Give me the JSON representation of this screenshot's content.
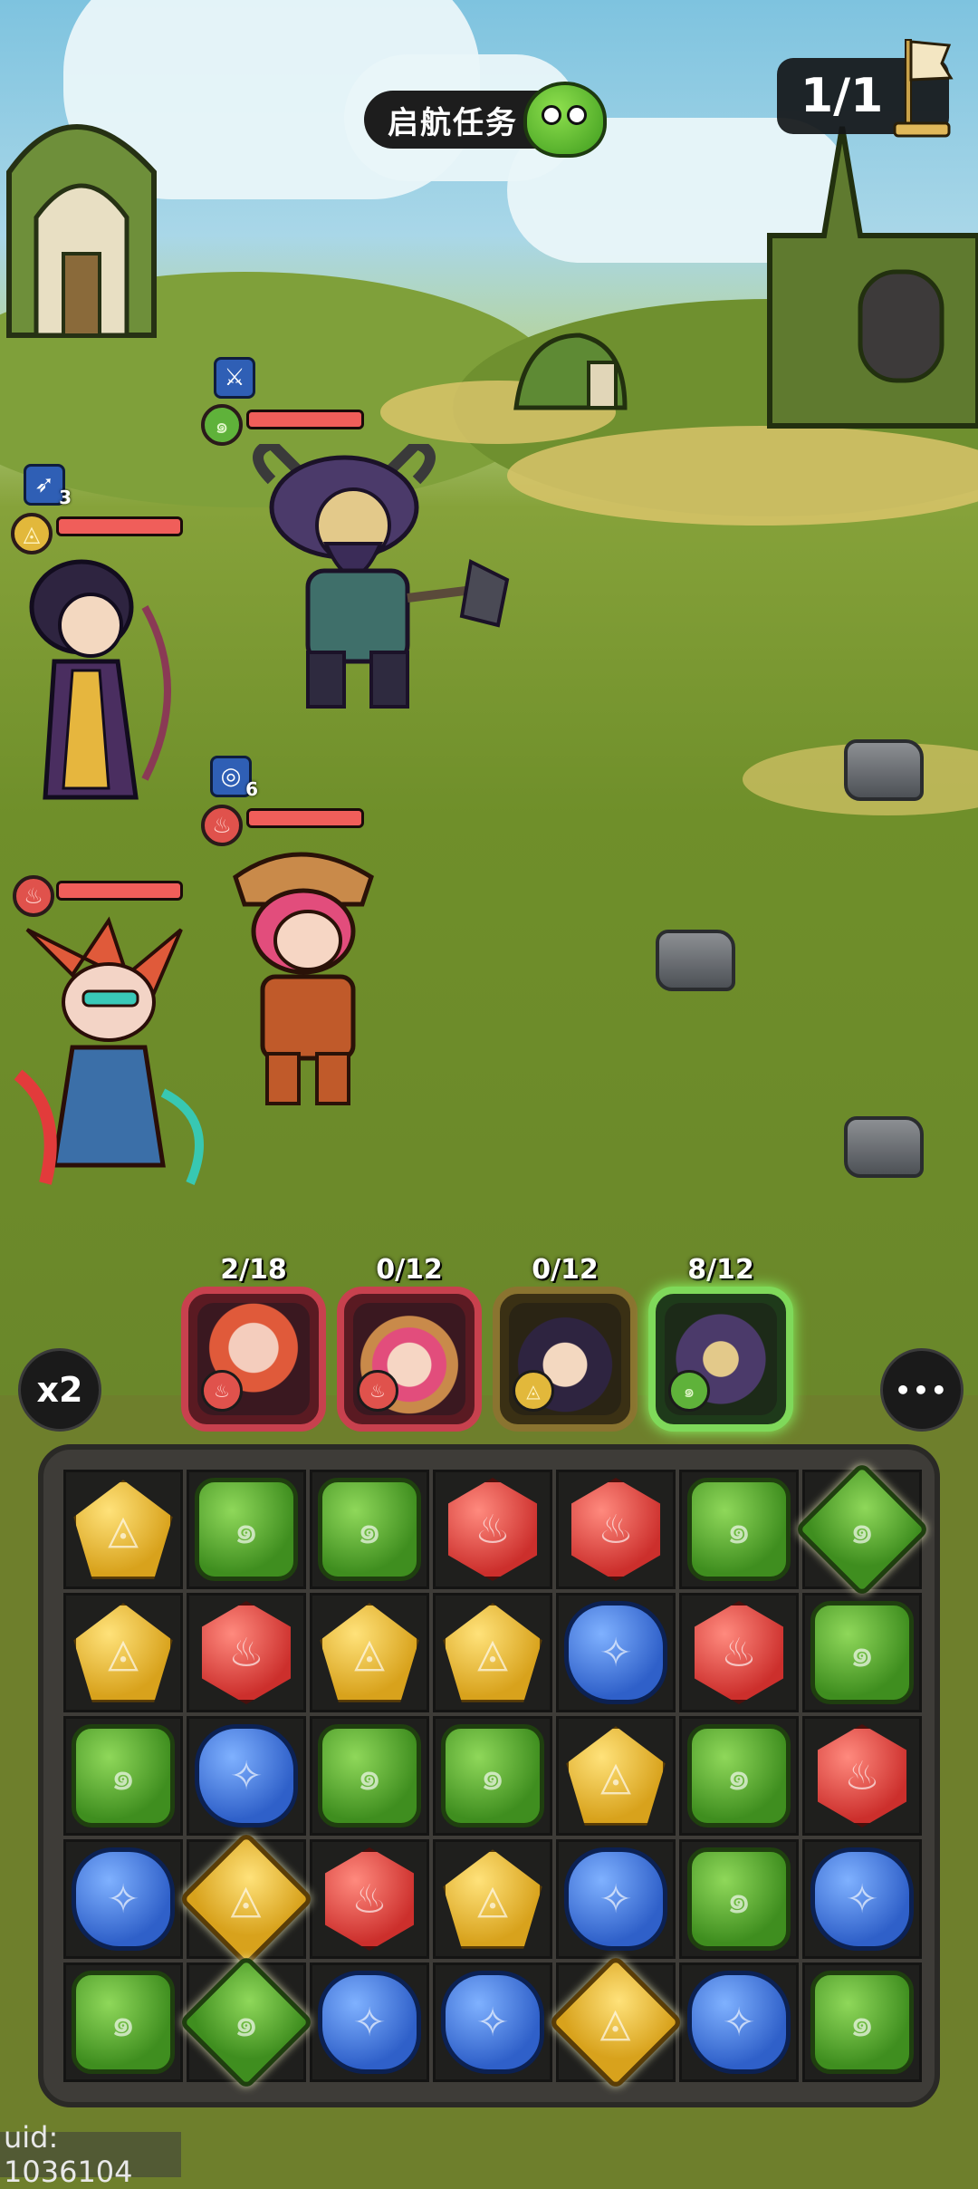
{
  "hud": {
    "mission_label": "启航任务",
    "wave_progress": "1/1"
  },
  "units": [
    {
      "id": "axe-warrior",
      "element": "wood",
      "hp_fraction": 1.0,
      "skill_icon": "sword-icon"
    },
    {
      "id": "archer",
      "element": "light",
      "hp_fraction": 1.0,
      "skill_icon": "bow-icon",
      "skill_count": "3"
    },
    {
      "id": "engineer",
      "element": "fire",
      "hp_fraction": 1.0,
      "skill_icon": "shield-ring-icon",
      "skill_count": "6"
    },
    {
      "id": "dragon-lady",
      "element": "fire",
      "hp_fraction": 1.0
    }
  ],
  "team": [
    {
      "name": "dragon-lady",
      "energy": "2/18",
      "element": "fire"
    },
    {
      "name": "engineer",
      "energy": "0/12",
      "element": "fire"
    },
    {
      "name": "archer",
      "energy": "0/12",
      "element": "light"
    },
    {
      "name": "axe-warrior",
      "energy": "8/12",
      "element": "wood"
    }
  ],
  "controls": {
    "speed_label": "x2",
    "more_label": "•••"
  },
  "board": [
    [
      "light",
      "wood",
      "wood",
      "fire",
      "fire",
      "wood",
      "wood*"
    ],
    [
      "light",
      "fire",
      "light",
      "light",
      "water",
      "fire",
      "wood"
    ],
    [
      "wood",
      "water",
      "wood",
      "wood",
      "light",
      "wood",
      "fire"
    ],
    [
      "water",
      "light*",
      "fire",
      "light",
      "water",
      "wood",
      "water"
    ],
    [
      "wood",
      "wood*",
      "water",
      "water",
      "light*",
      "water",
      "wood"
    ]
  ],
  "colors": {
    "wood": "#3f8e1f",
    "light": "#d8a21c",
    "fire": "#cc2f2c",
    "water": "#2f60c9"
  },
  "footer": {
    "uid_text": "uid: 1036104"
  }
}
